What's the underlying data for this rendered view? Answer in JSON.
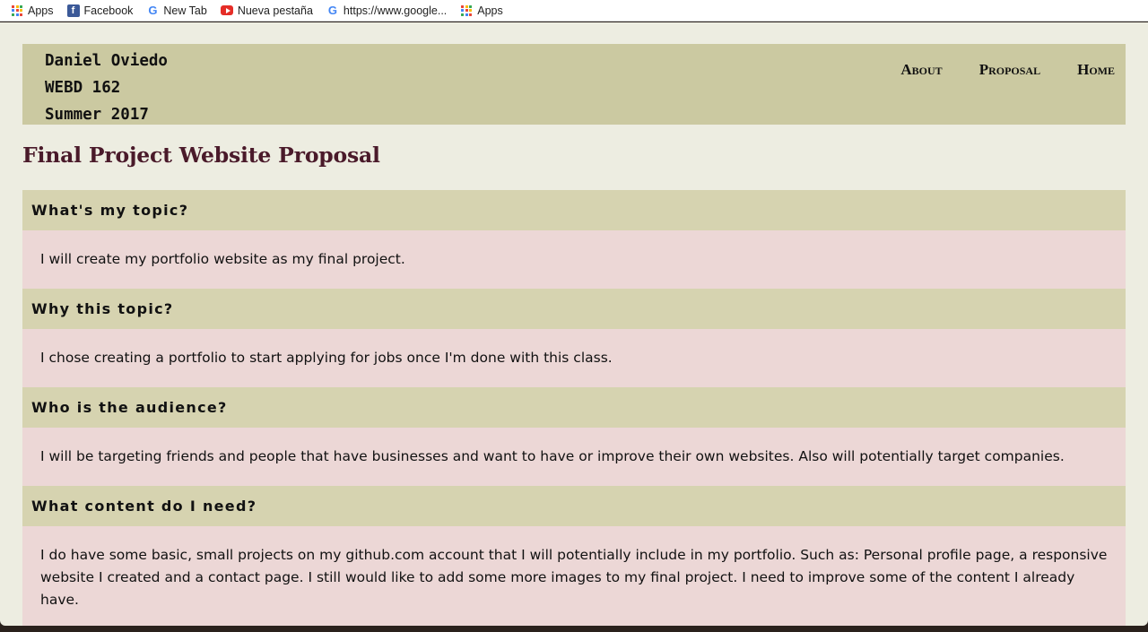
{
  "bookmarks": [
    {
      "icon": "apps-icon",
      "label": "Apps"
    },
    {
      "icon": "facebook-icon",
      "label": "Facebook"
    },
    {
      "icon": "google-icon",
      "label": "New Tab"
    },
    {
      "icon": "youtube-icon",
      "label": "Nueva pestaña"
    },
    {
      "icon": "google-icon",
      "label": "https://www.google..."
    },
    {
      "icon": "apps-icon",
      "label": "Apps"
    }
  ],
  "header": {
    "lines": [
      "Daniel Oviedo",
      "WEBD 162",
      "Summer 2017"
    ]
  },
  "nav": [
    {
      "label": "About"
    },
    {
      "label": "Proposal"
    },
    {
      "label": "Home"
    }
  ],
  "page_title": "Final Project Website Proposal",
  "sections": [
    {
      "question": "What's my topic?",
      "answer": "I will create my portfolio website as my final project."
    },
    {
      "question": "Why this topic?",
      "answer": "I chose creating a portfolio to start applying for jobs once I'm done with this class."
    },
    {
      "question": "Who is the audience?",
      "answer": "I will be targeting friends and people that have businesses and want to have or improve their own websites. Also will potentially target companies."
    },
    {
      "question": "What content do I need?",
      "answer": "I do have some basic, small projects on my github.com account that I will potentially include in my portfolio. Such as: Personal profile page, a responsive website I created and a contact page. I still would like to add some more images to my final project. I need to improve some of the content I already have."
    }
  ],
  "colors": {
    "page_bg": "#edede1",
    "header_bg": "#cbc9a1",
    "question_bg": "#d6d3b0",
    "answer_bg": "#ecd7d6",
    "title_color": "#4a1a2a"
  }
}
